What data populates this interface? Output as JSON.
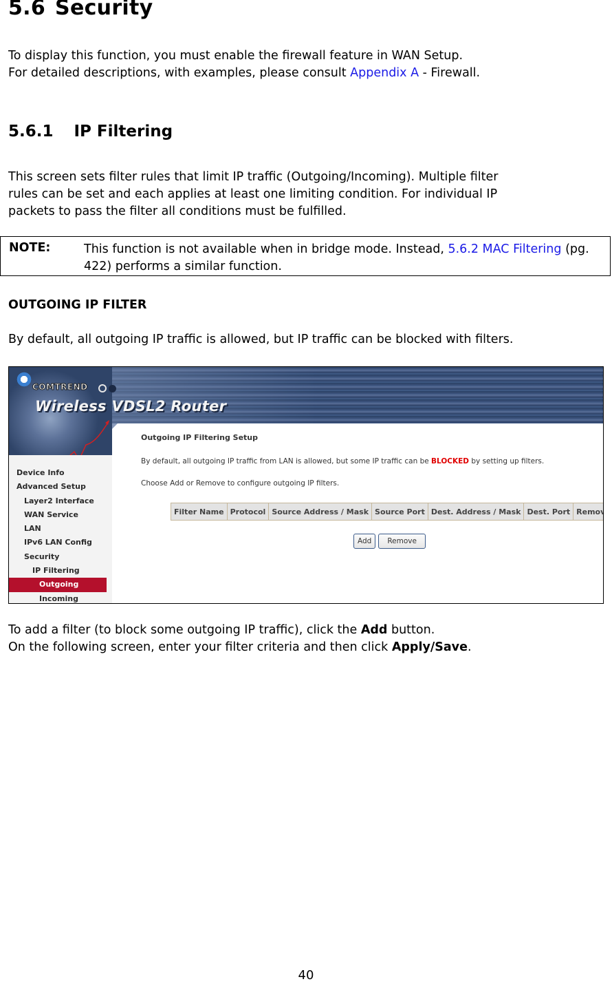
{
  "section": {
    "number": "5.6",
    "title": "Security",
    "intro_line1": "To display this function, you must enable the firewall feature in WAN Setup.",
    "intro_line2_prefix": "For detailed descriptions, with examples, please consult ",
    "intro_link": "Appendix A",
    "intro_line2_suffix": " - Firewall."
  },
  "subsection": {
    "number": "5.6.1",
    "title": "IP Filtering",
    "paragraph_lines": [
      "This screen sets filter rules that limit IP traffic (Outgoing/Incoming). Multiple filter",
      "rules can be set and each applies at least one limiting condition. For individual IP",
      "packets to pass the filter all conditions must be fulfilled."
    ]
  },
  "note": {
    "label": "NOTE:",
    "text_prefix": "This function is not available when in bridge mode. Instead, ",
    "link": "5.6.2 MAC Filtering",
    "text_suffix": " (pg. 422) performs a similar function."
  },
  "outgoing": {
    "heading": "OUTGOING IP FILTER",
    "description": "By default, all outgoing IP traffic is allowed, but IP traffic can be blocked with filters."
  },
  "screenshot": {
    "brand": "COMTREND",
    "product": "Wireless VDSL2 Router",
    "sidebar": [
      {
        "label": "Device Info",
        "level": 0
      },
      {
        "label": "Advanced Setup",
        "level": 0
      },
      {
        "label": "Layer2 Interface",
        "level": 1
      },
      {
        "label": "WAN Service",
        "level": 1
      },
      {
        "label": "LAN",
        "level": 1
      },
      {
        "label": "IPv6 LAN Config",
        "level": 1
      },
      {
        "label": "Security",
        "level": 1
      },
      {
        "label": "IP Filtering",
        "level": 2
      },
      {
        "label": "Outgoing",
        "level": 3,
        "active": true
      },
      {
        "label": "Incoming",
        "level": 3
      }
    ],
    "title": "Outgoing IP Filtering Setup",
    "line1_prefix": "By default, all outgoing IP traffic from LAN is allowed, but some IP traffic can be ",
    "line1_blocked": "BLOCKED",
    "line1_suffix": " by setting up filters.",
    "line2": "Choose Add or Remove to configure outgoing IP filters.",
    "table_headers": [
      "Filter Name",
      "Protocol",
      "Source Address / Mask",
      "Source Port",
      "Dest. Address / Mask",
      "Dest. Port",
      "Remove"
    ],
    "add_button": "Add",
    "remove_button": "Remove",
    "accent_color": "#b4102c",
    "blocked_color": "#e00000"
  },
  "after": {
    "line1_prefix": "To add a filter (to block some outgoing IP traffic), click the ",
    "line1_bold": "Add",
    "line1_suffix": " button.",
    "line2_prefix": "On the following screen, enter your filter criteria and then click ",
    "line2_bold": "Apply/Save",
    "line2_suffix": "."
  },
  "page_number": "40"
}
